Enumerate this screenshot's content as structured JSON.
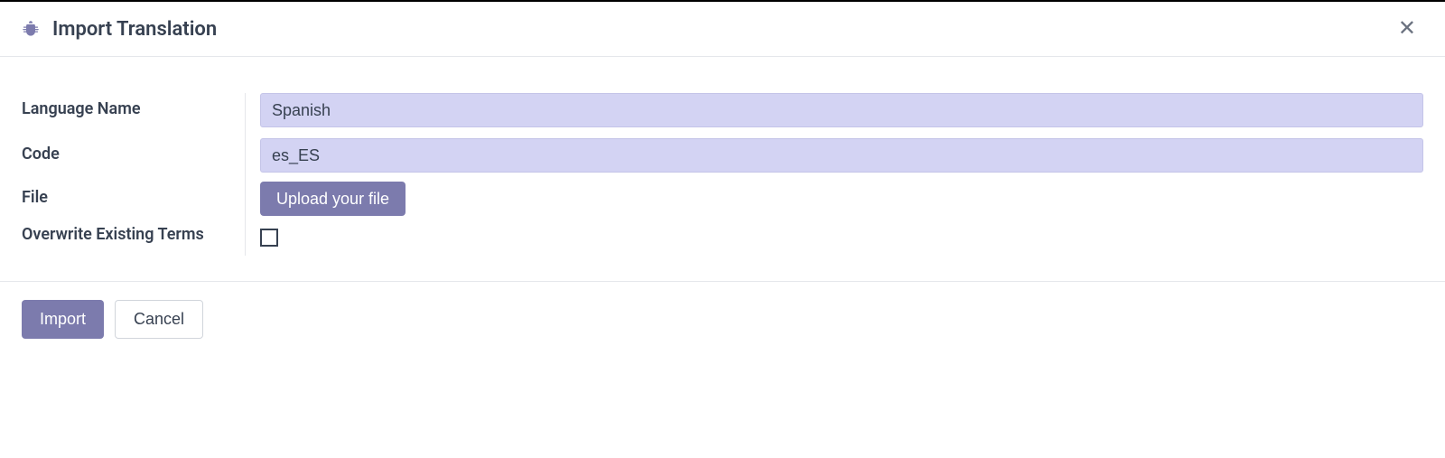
{
  "header": {
    "title": "Import Translation"
  },
  "form": {
    "labels": {
      "language_name": "Language Name",
      "code": "Code",
      "file": "File",
      "overwrite": "Overwrite Existing Terms"
    },
    "values": {
      "language_name": "Spanish",
      "code": "es_ES",
      "overwrite_checked": false
    },
    "upload_button": "Upload your file"
  },
  "footer": {
    "import": "Import",
    "cancel": "Cancel"
  }
}
